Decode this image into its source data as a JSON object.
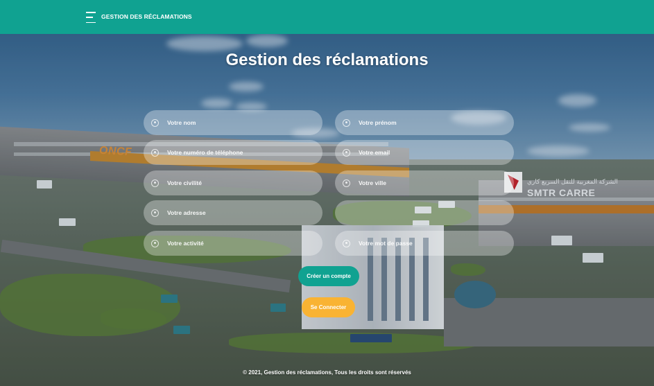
{
  "navbar": {
    "brand": "GESTION DES RÉCLAMATIONS",
    "toggle_icon": "hamburger-menu-icon",
    "background_color": "#10a291"
  },
  "main": {
    "title": "Gestion des réclamations",
    "form": {
      "fields": [
        {
          "name": "nom",
          "placeholder": "Votre nom",
          "value": ""
        },
        {
          "name": "prenom",
          "placeholder": "Votre prénom",
          "value": ""
        },
        {
          "name": "telephone",
          "placeholder": "Votre numéro de téléphone",
          "value": ""
        },
        {
          "name": "email",
          "placeholder": "Votre email",
          "value": ""
        },
        {
          "name": "civilite",
          "placeholder": "Votre civilité",
          "value": ""
        },
        {
          "name": "ville",
          "placeholder": "Votre ville",
          "value": ""
        },
        {
          "name": "adresse",
          "placeholder": "Votre adresse",
          "value": ""
        },
        {
          "name": "activite",
          "placeholder": "Votre activité",
          "value": ""
        },
        {
          "name": "mot_de_passe",
          "placeholder": "Votre mot de passe",
          "value": ""
        }
      ],
      "field_icon": "user-icon",
      "create_button_label": "Créer un compte",
      "login_button_label": "Se Connecter"
    },
    "background_logos": {
      "left_logo": "ONCF",
      "right_logo": "SMTR CARRE",
      "right_logo_arabic": "الشركة المغربية للنقل السريع كاري"
    }
  },
  "footer": {
    "text": "© 2021, Gestion des réclamations, Tous les droits sont réservés"
  },
  "colors": {
    "primary": "#10a291",
    "accent": "#f9b333",
    "text": "#ffffff"
  }
}
